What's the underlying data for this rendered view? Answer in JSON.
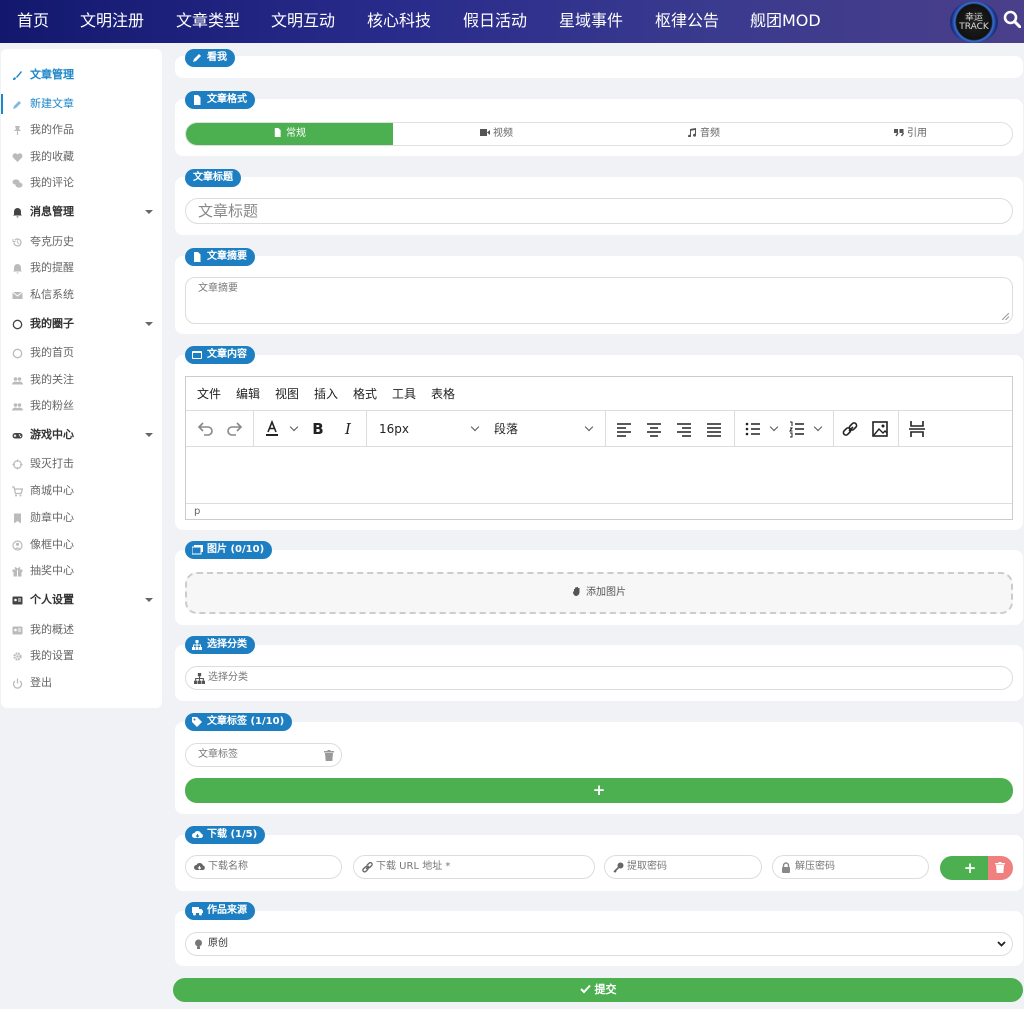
{
  "topnav": {
    "items": [
      "首页",
      "文明注册",
      "文章类型",
      "文明互动",
      "核心科技",
      "假日活动",
      "星域事件",
      "枢律公告",
      "舰团MOD"
    ],
    "avatar_text": "幸运 TRACK",
    "search_icon": "search-icon"
  },
  "sidebar": {
    "items": [
      {
        "label": "文章管理",
        "icon": "brush-icon",
        "type": "group"
      },
      {
        "label": "新建文章",
        "icon": "pen-icon",
        "type": "item",
        "active": true
      },
      {
        "label": "我的作品",
        "icon": "pin-icon",
        "type": "item"
      },
      {
        "label": "我的收藏",
        "icon": "heart-icon",
        "type": "item"
      },
      {
        "label": "我的评论",
        "icon": "comments-icon",
        "type": "item"
      },
      {
        "label": "消息管理",
        "icon": "bell-icon",
        "type": "group",
        "expandable": true
      },
      {
        "label": "夸克历史",
        "icon": "history-icon",
        "type": "item"
      },
      {
        "label": "我的提醒",
        "icon": "bell-icon",
        "type": "item"
      },
      {
        "label": "私信系统",
        "icon": "envelope-icon",
        "type": "item"
      },
      {
        "label": "我的圈子",
        "icon": "circle-icon",
        "type": "group",
        "expandable": true
      },
      {
        "label": "我的首页",
        "icon": "circle-icon",
        "type": "item"
      },
      {
        "label": "我的关注",
        "icon": "users-icon",
        "type": "item"
      },
      {
        "label": "我的粉丝",
        "icon": "users-icon",
        "type": "item"
      },
      {
        "label": "游戏中心",
        "icon": "gamepad-icon",
        "type": "group",
        "expandable": true
      },
      {
        "label": "毁灭打击",
        "icon": "crosshair-icon",
        "type": "item"
      },
      {
        "label": "商城中心",
        "icon": "cart-icon",
        "type": "item"
      },
      {
        "label": "勋章中心",
        "icon": "bookmark-icon",
        "type": "item"
      },
      {
        "label": "像框中心",
        "icon": "user-circle-icon",
        "type": "item"
      },
      {
        "label": "抽奖中心",
        "icon": "gift-icon",
        "type": "item"
      },
      {
        "label": "个人设置",
        "icon": "id-card-icon",
        "type": "group",
        "expandable": true
      },
      {
        "label": "我的概述",
        "icon": "id-card-icon",
        "type": "item"
      },
      {
        "label": "我的设置",
        "icon": "gear-icon",
        "type": "item"
      },
      {
        "label": "登出",
        "icon": "power-icon",
        "type": "item"
      }
    ]
  },
  "sections": {
    "look": {
      "label": "看我"
    },
    "format": {
      "label": "文章格式",
      "tabs": [
        {
          "label": "常规",
          "icon": "file-icon",
          "active": true
        },
        {
          "label": "视频",
          "icon": "video-icon"
        },
        {
          "label": "音频",
          "icon": "music-icon"
        },
        {
          "label": "引用",
          "icon": "quote-icon"
        }
      ]
    },
    "title": {
      "label": "文章标题",
      "placeholder": "文章标题"
    },
    "summary": {
      "label": "文章摘要",
      "placeholder": "文章摘要"
    },
    "content": {
      "label": "文章内容",
      "menu": [
        "文件",
        "编辑",
        "视图",
        "插入",
        "格式",
        "工具",
        "表格"
      ],
      "font_size": "16px",
      "block_format": "段落",
      "status_path": "p"
    },
    "images": {
      "label": "图片 (0/10)",
      "dropzone": "添加图片"
    },
    "category": {
      "label": "选择分类",
      "placeholder": "选择分类"
    },
    "tags": {
      "label": "文章标签 (1/10)",
      "tag_placeholder": "文章标签",
      "add_label": "+"
    },
    "download": {
      "label": "下载 (1/5)",
      "name_placeholder": "下载名称",
      "url_placeholder": "下载 URL 地址 *",
      "code_placeholder": "提取密码",
      "unzip_placeholder": "解压密码",
      "add_label": "+"
    },
    "source": {
      "label": "作品来源",
      "selected": "原创"
    }
  },
  "submit": {
    "label": "提交"
  },
  "colors": {
    "accent": "#1d7fc1",
    "green": "#4caf50",
    "red": "#f08080",
    "nav_start": "#13186e",
    "nav_end": "#4a3f8a"
  }
}
